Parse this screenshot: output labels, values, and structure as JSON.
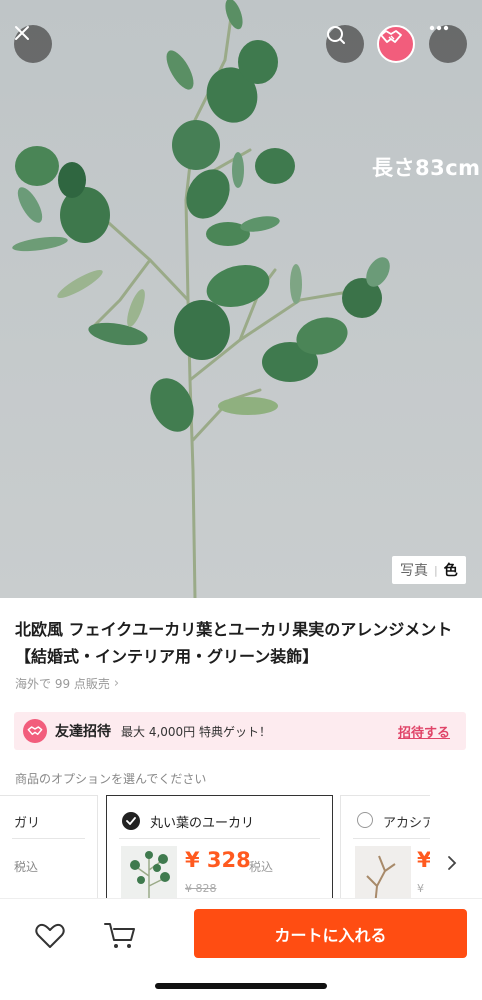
{
  "hero": {
    "length_label": "長さ83cm",
    "toggle_photo": "写真",
    "toggle_color": "色"
  },
  "top_buttons": {
    "close_icon": "close-icon",
    "search_icon": "search-icon",
    "brand_icon": "handshake-icon",
    "more_icon": "more-icon"
  },
  "product": {
    "title": "北欧風 フェイクユーカリ葉とユーカリ果実のアレンジメント【結婚式・インテリア用・グリーン装飾】",
    "sales": "海外で 99 点販売"
  },
  "referral": {
    "title": "友達招待",
    "description": "最大 4,000円 特典ゲット！",
    "link": "招待する"
  },
  "options": {
    "heading": "商品のオプションを選んでください",
    "items": [
      {
        "name": "ガリ",
        "tax": "税込"
      },
      {
        "name": "丸い葉のユーカリ",
        "price": "¥ 328",
        "tax": "税込",
        "original_price": "¥ 828",
        "selected": true
      },
      {
        "name": "アカシア",
        "price_fragment": "¥",
        "original_fragment": "¥",
        "selected": false
      }
    ]
  },
  "bottom": {
    "add_to_cart": "カートに入れる"
  },
  "colors": {
    "accent": "#ff4d12",
    "price": "#ff5a1f",
    "pink": "#f25d7c",
    "banner_bg": "#fdebef"
  }
}
